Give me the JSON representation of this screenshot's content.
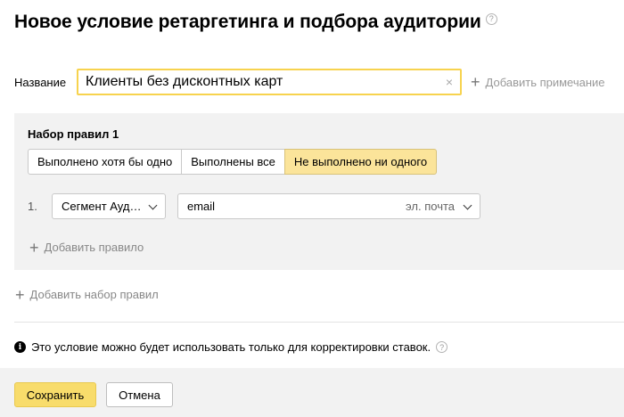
{
  "header": {
    "title": "Новое условие ретаргетинга и подбора аудитории",
    "help_glyph": "?"
  },
  "name_field": {
    "label": "Название",
    "value": "Клиенты без дисконтных карт",
    "clear_glyph": "×",
    "add_note_label": "Добавить примечание"
  },
  "ruleset": {
    "title": "Набор правил 1",
    "match_modes": [
      {
        "label": "Выполнено хотя бы одно",
        "active": false
      },
      {
        "label": "Выполнены все",
        "active": false
      },
      {
        "label": "Не выполнено ни одного",
        "active": true
      }
    ],
    "rules": [
      {
        "number": "1.",
        "type_label": "Сегмент Ауд…",
        "value_label": "email",
        "value_hint": "эл. почта"
      }
    ],
    "add_rule_label": "Добавить правило"
  },
  "add_ruleset_label": "Добавить набор правил",
  "notice": {
    "info_glyph": "i",
    "text": "Это условие можно будет использовать только для корректировки ставок.",
    "help_glyph": "?"
  },
  "footer": {
    "save_label": "Сохранить",
    "cancel_label": "Отмена"
  },
  "icons": {
    "plus_glyph": "+"
  },
  "colors": {
    "accent_yellow": "#f8dc6b",
    "active_segment": "#fbe49a",
    "input_focus_border": "#f7d34e",
    "panel_background": "#f2f2f2"
  }
}
